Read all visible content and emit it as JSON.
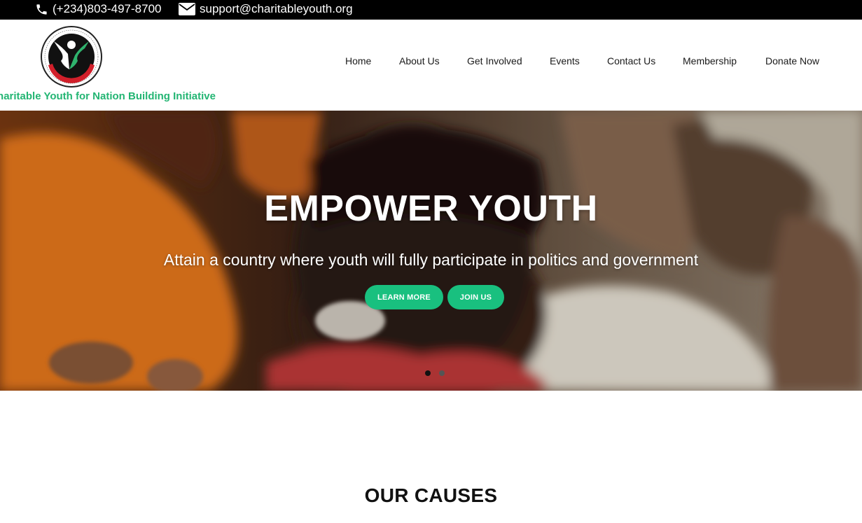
{
  "topbar": {
    "phone": "(+234)803-497-8700",
    "email": "support@charitableyouth.org"
  },
  "header": {
    "org_name": "Charitable Youth for Nation Building Initiative",
    "logo_text": "CHARITABLE YOUTH FOR NATION BUILDING INITIATIVE"
  },
  "nav": {
    "items": [
      {
        "label": "Home"
      },
      {
        "label": "About Us"
      },
      {
        "label": "Get Involved"
      },
      {
        "label": "Events"
      },
      {
        "label": "Contact Us"
      },
      {
        "label": "Membership"
      },
      {
        "label": "Donate Now"
      }
    ]
  },
  "hero": {
    "title": "EMPOWER YOUTH",
    "subtitle": "Attain a country where youth will fully participate in politics and government",
    "learn_more": "LEARN MORE",
    "join_us": "JOIN US",
    "slides_total": 2,
    "active_slide": 1
  },
  "causes": {
    "title": "OUR CAUSES"
  },
  "colors": {
    "accent": "#19c07f",
    "brand_green": "#23b573",
    "topbar": "#000000"
  }
}
